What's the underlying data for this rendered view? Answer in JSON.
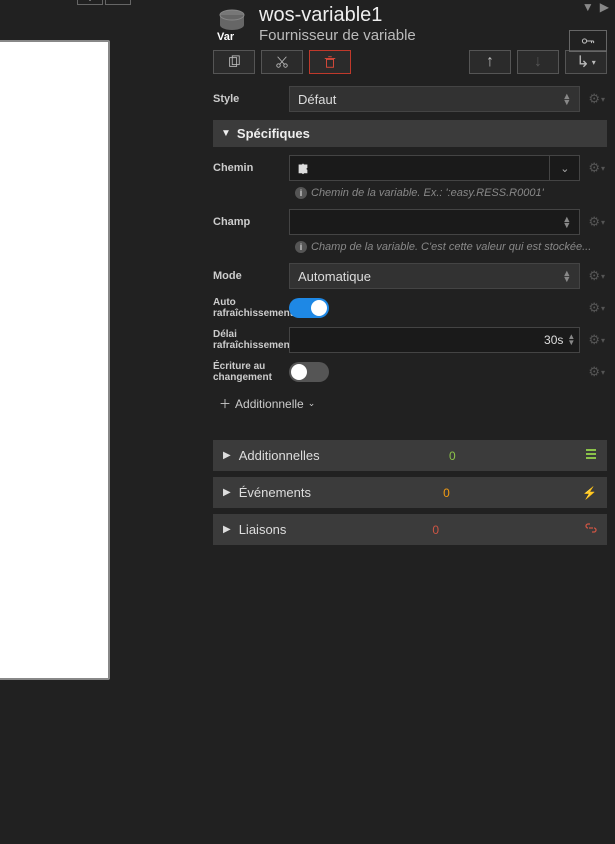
{
  "toolbar": {
    "dimension": "1080px"
  },
  "header": {
    "icon_label": "Var",
    "title": "wos-variable1",
    "subtitle": "Fournisseur de variable"
  },
  "style_row": {
    "label": "Style",
    "value": "Défaut"
  },
  "section_specifiques": {
    "title": "Spécifiques"
  },
  "chemin": {
    "label": "Chemin",
    "value": "",
    "hint": "Chemin de la variable. Ex.: ':easy.RESS.R0001'"
  },
  "champ": {
    "label": "Champ",
    "value": "",
    "hint": "Champ de la variable. C'est cette valeur qui est stockée..."
  },
  "mode": {
    "label": "Mode",
    "value": "Automatique"
  },
  "auto_refresh": {
    "label": "Auto rafraîchissement",
    "on": true
  },
  "refresh_delay": {
    "label": "Délai rafraîchissement",
    "value": "30s"
  },
  "write_on_change": {
    "label": "Écriture au changement",
    "on": false
  },
  "additional_button": {
    "label": "Additionnelle"
  },
  "sections": {
    "additionnelles": {
      "label": "Additionnelles",
      "count": "0"
    },
    "evenements": {
      "label": "Événements",
      "count": "0"
    },
    "liaisons": {
      "label": "Liaisons",
      "count": "0"
    }
  }
}
